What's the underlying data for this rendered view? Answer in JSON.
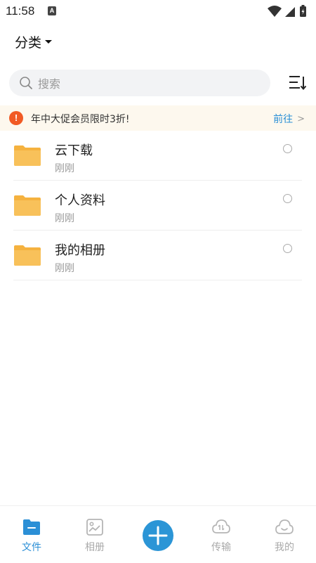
{
  "status_bar": {
    "time": "11:58",
    "notification_badge": "A",
    "icons": [
      "wifi-icon",
      "signal-icon",
      "battery-charging-icon"
    ]
  },
  "header": {
    "category_label": "分类",
    "search_placeholder": "搜索"
  },
  "banner": {
    "text": "年中大促会员限时3折!",
    "link_label": "前往",
    "chevron": ">",
    "alert_glyph": "!",
    "alert_color": "#f15a24",
    "link_color": "#2b8fd6"
  },
  "files": [
    {
      "name": "云下载",
      "time": "刚刚",
      "icon": "folder-icon"
    },
    {
      "name": "个人资料",
      "time": "刚刚",
      "icon": "folder-icon"
    },
    {
      "name": "我的相册",
      "time": "刚刚",
      "icon": "folder-icon"
    }
  ],
  "tabbar": {
    "tabs": [
      {
        "label": "文件",
        "icon": "file-folder-icon",
        "active": true
      },
      {
        "label": "相册",
        "icon": "photo-icon",
        "active": false
      },
      {
        "label": "传输",
        "icon": "cloud-transfer-icon",
        "active": false
      },
      {
        "label": "我的",
        "icon": "smile-cloud-icon",
        "active": false
      }
    ],
    "fab_icon": "plus-icon"
  },
  "colors": {
    "accent": "#2b8fd6",
    "folder": "#f5b23f",
    "banner_bg": "#fdf8ee",
    "search_bg": "#f2f3f5"
  }
}
